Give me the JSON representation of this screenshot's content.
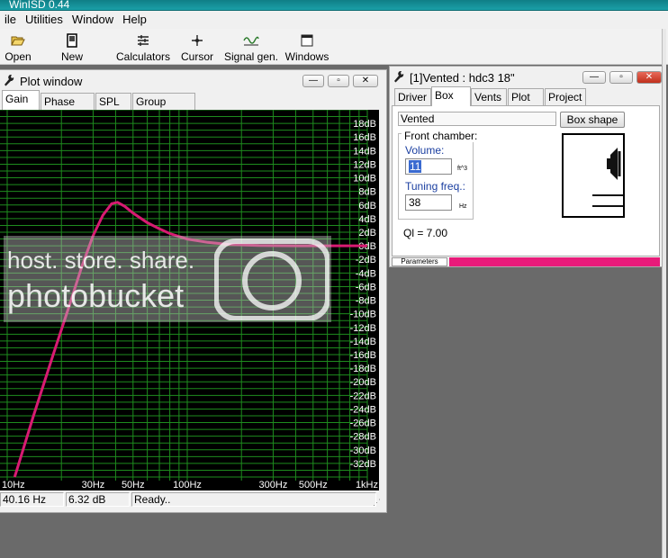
{
  "app": {
    "title": "WinISD 0.44"
  },
  "menu": [
    "ile",
    "Utilities",
    "Window",
    "Help"
  ],
  "toolbar": [
    {
      "label": "Open",
      "icon": "folder-open-icon"
    },
    {
      "label": "New",
      "icon": "new-document-icon"
    },
    {
      "label": "Calculators",
      "icon": "calculator-icon"
    },
    {
      "label": "Cursor",
      "icon": "cursor-icon"
    },
    {
      "label": "Signal gen.",
      "icon": "sine-wave-icon"
    },
    {
      "label": "Windows",
      "icon": "window-icon"
    }
  ],
  "plot_window": {
    "title": "Plot window",
    "tabs": [
      "Gain",
      "Phase plot",
      "SPL",
      "Group delay"
    ],
    "active_tab": "Gain",
    "status": {
      "freq": "40.16 Hz",
      "gain": "6.32 dB",
      "state": "Ready.."
    }
  },
  "chart_data": {
    "type": "line",
    "title": "",
    "xlabel": "",
    "ylabel": "",
    "xscale": "log",
    "xlim": [
      10,
      1000
    ],
    "ylim": [
      -34,
      20
    ],
    "grid": true,
    "xticks": [
      {
        "v": 10,
        "label": "10Hz"
      },
      {
        "v": 30,
        "label": "30Hz"
      },
      {
        "v": 50,
        "label": "50Hz"
      },
      {
        "v": 100,
        "label": "100Hz"
      },
      {
        "v": 300,
        "label": "300Hz"
      },
      {
        "v": 500,
        "label": "500Hz"
      },
      {
        "v": 1000,
        "label": "1kHz"
      }
    ],
    "yticks": [
      {
        "v": 18,
        "label": "18dB"
      },
      {
        "v": 16,
        "label": "16dB"
      },
      {
        "v": 14,
        "label": "14dB"
      },
      {
        "v": 12,
        "label": "12dB"
      },
      {
        "v": 10,
        "label": "10dB"
      },
      {
        "v": 8,
        "label": "8dB"
      },
      {
        "v": 6,
        "label": "6dB"
      },
      {
        "v": 4,
        "label": "4dB"
      },
      {
        "v": 2,
        "label": "2dB"
      },
      {
        "v": 0,
        "label": "0dB"
      },
      {
        "v": -2,
        "label": "-2dB"
      },
      {
        "v": -4,
        "label": "-4dB"
      },
      {
        "v": -6,
        "label": "-6dB"
      },
      {
        "v": -8,
        "label": "-8dB"
      },
      {
        "v": -10,
        "label": "-10dB"
      },
      {
        "v": -12,
        "label": "-12dB"
      },
      {
        "v": -14,
        "label": "-14dB"
      },
      {
        "v": -16,
        "label": "-16dB"
      },
      {
        "v": -18,
        "label": "-18dB"
      },
      {
        "v": -20,
        "label": "-20dB"
      },
      {
        "v": -22,
        "label": "-22dB"
      },
      {
        "v": -24,
        "label": "-24dB"
      },
      {
        "v": -26,
        "label": "-26dB"
      },
      {
        "v": -28,
        "label": "-28dB"
      },
      {
        "v": -30,
        "label": "-30dB"
      },
      {
        "v": -32,
        "label": "-32dB"
      }
    ],
    "series": [
      {
        "color": "#d81b72",
        "points": [
          [
            11,
            -34
          ],
          [
            14,
            -25
          ],
          [
            18,
            -16
          ],
          [
            22,
            -9
          ],
          [
            26,
            -3
          ],
          [
            30,
            1.5
          ],
          [
            34,
            4.5
          ],
          [
            38,
            6.2
          ],
          [
            41,
            6.4
          ],
          [
            45,
            5.8
          ],
          [
            50,
            4.8
          ],
          [
            60,
            3.4
          ],
          [
            70,
            2.5
          ],
          [
            80,
            1.8
          ],
          [
            100,
            1
          ],
          [
            130,
            0.5
          ],
          [
            170,
            0.2
          ],
          [
            250,
            0.05
          ],
          [
            400,
            0
          ],
          [
            1000,
            0
          ]
        ]
      }
    ]
  },
  "box_window": {
    "title": "[1]Vented : hdc3 18\"",
    "tabs": [
      "Driver",
      "Box",
      "Vents",
      "Plot",
      "Project"
    ],
    "active_tab": "Box",
    "box_type": "Vented",
    "box_shape_button": "Box shape",
    "group_label": "Front chamber:",
    "volume_label": "Volume:",
    "volume_value": "11",
    "volume_unit": "ft^3",
    "tuning_label": "Tuning freq.:",
    "tuning_value": "38",
    "tuning_unit": "Hz",
    "ql_text": "Ql = 7.00",
    "params_tab": "Parameters"
  },
  "watermark": {
    "line1": "host. store. share.",
    "line2": "photobucket"
  },
  "colors": {
    "curve": "#d81b72",
    "grid": "#1e8c1e",
    "title_teal": "#1aa0a8"
  }
}
